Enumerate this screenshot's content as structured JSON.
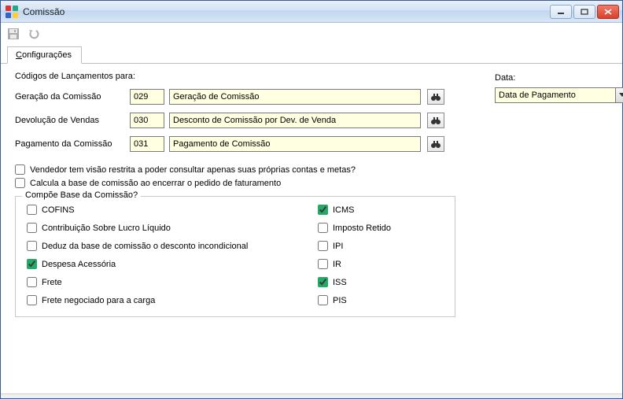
{
  "window": {
    "title": "Comissão"
  },
  "tabs": {
    "config_first_char": "C",
    "config_rest": "onfigurações"
  },
  "section": {
    "codigos_label": "Códigos de Lançamentos para:"
  },
  "rows": {
    "geracao": {
      "label": "Geração da Comissão",
      "code": "029",
      "desc": "Geração de Comissão"
    },
    "devolucao": {
      "label": "Devolução de Vendas",
      "code": "030",
      "desc": "Desconto de Comissão por Dev. de Venda"
    },
    "pagamento": {
      "label": "Pagamento da Comissão",
      "code": "031",
      "desc": "Pagamento de Comissão"
    }
  },
  "options": {
    "vendedor_restrito": "Vendedor tem visão restrita a poder consultar apenas suas próprias contas e metas?",
    "calcula_base": "Calcula a base de comissão ao encerrar o pedido de faturamento"
  },
  "fieldset": {
    "legend": "Compõe Base da Comissão?",
    "col1": {
      "cofins": "COFINS",
      "csll": "Contribuição Sobre Lucro Líquido",
      "deduz": "Deduz da base de comissão o desconto incondicional",
      "despesa": "Despesa Acessória",
      "frete": "Frete",
      "frete_neg": "Frete negociado para a carga"
    },
    "col2": {
      "icms": "ICMS",
      "imposto_retido": "Imposto Retido",
      "ipi": "IPI",
      "ir": "IR",
      "iss": "ISS",
      "pis": "PIS"
    }
  },
  "data_panel": {
    "label": "Data:",
    "selected": "Data de Pagamento"
  }
}
